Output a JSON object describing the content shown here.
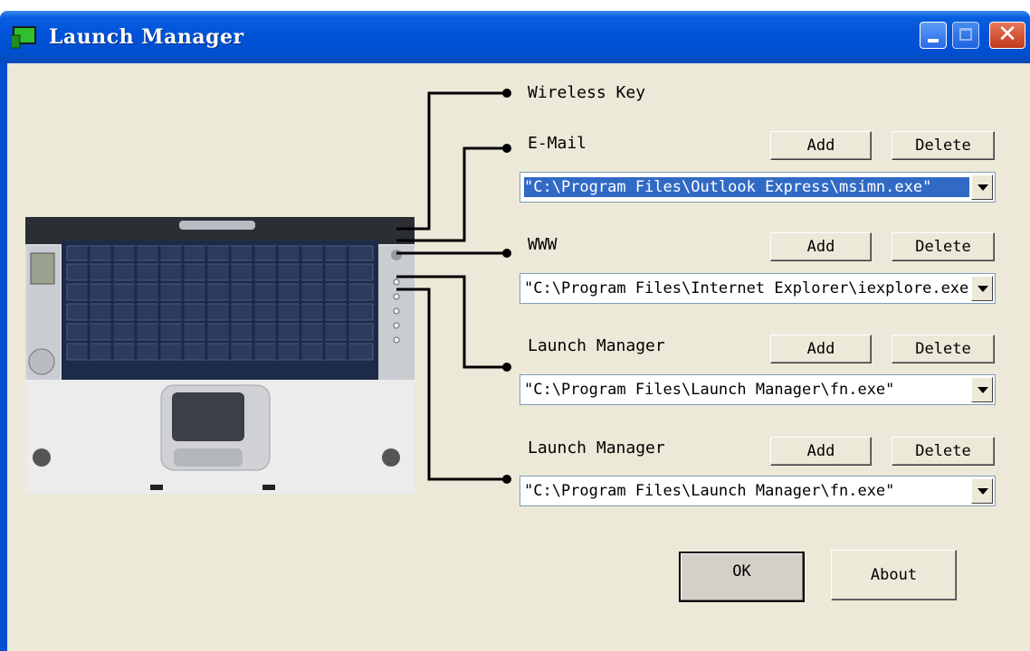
{
  "window": {
    "title": "Launch Manager",
    "icon": "launch-manager-app-icon",
    "controls": {
      "minimize": "minimize-icon",
      "maximize": "maximize-icon",
      "close": "close-icon"
    }
  },
  "colors": {
    "titlebar": "#0053d8",
    "client_bg": "#ece9d8",
    "selection": "#316ac5",
    "close": "#c1391a"
  },
  "keys": [
    {
      "label": "Wireless Key"
    },
    {
      "label": "E-Mail",
      "add": "Add",
      "delete": "Delete",
      "path": "\"C:\\Program Files\\Outlook Express\\msimn.exe\"",
      "selected": true
    },
    {
      "label": "WWW",
      "add": "Add",
      "delete": "Delete",
      "path": "\"C:\\Program Files\\Internet Explorer\\iexplore.exe\""
    },
    {
      "label": "Launch Manager",
      "add": "Add",
      "delete": "Delete",
      "path": "\"C:\\Program Files\\Launch Manager\\fn.exe\""
    },
    {
      "label": "Launch Manager",
      "add": "Add",
      "delete": "Delete",
      "path": "\"C:\\Program Files\\Launch Manager\\fn.exe\""
    }
  ],
  "footer": {
    "ok": "OK",
    "about": "About"
  }
}
